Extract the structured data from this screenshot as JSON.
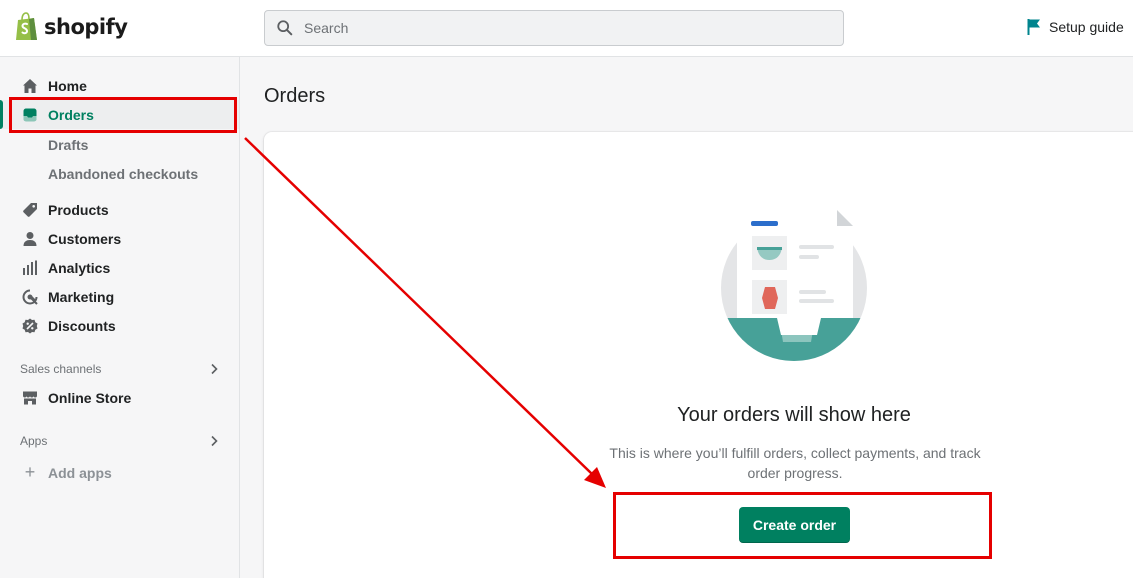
{
  "brand": {
    "name": "shopify",
    "accent": "#95bf47"
  },
  "search": {
    "placeholder": "Search"
  },
  "header": {
    "setup_guide": "Setup guide",
    "flag_color": "#00848e"
  },
  "sidebar": {
    "items": [
      {
        "label": "Home",
        "icon": "home-icon"
      },
      {
        "label": "Orders",
        "icon": "orders-icon",
        "active": true
      },
      {
        "label": "Products",
        "icon": "tag-icon"
      },
      {
        "label": "Customers",
        "icon": "person-icon"
      },
      {
        "label": "Analytics",
        "icon": "bar-chart-icon"
      },
      {
        "label": "Marketing",
        "icon": "target-icon"
      },
      {
        "label": "Discounts",
        "icon": "discount-icon"
      }
    ],
    "orders_subitems": [
      "Drafts",
      "Abandoned checkouts"
    ],
    "sales_channels": {
      "heading": "Sales channels",
      "items": [
        {
          "label": "Online Store",
          "icon": "store-icon"
        }
      ]
    },
    "apps": {
      "heading": "Apps",
      "add_label": "Add apps"
    }
  },
  "main": {
    "title": "Orders",
    "empty_state": {
      "heading": "Your orders will show here",
      "body": "This is where you’ll fulfill orders, collect payments, and track order progress.",
      "button": "Create order"
    }
  },
  "colors": {
    "primary": "#008060",
    "annotation": "#e50000"
  }
}
